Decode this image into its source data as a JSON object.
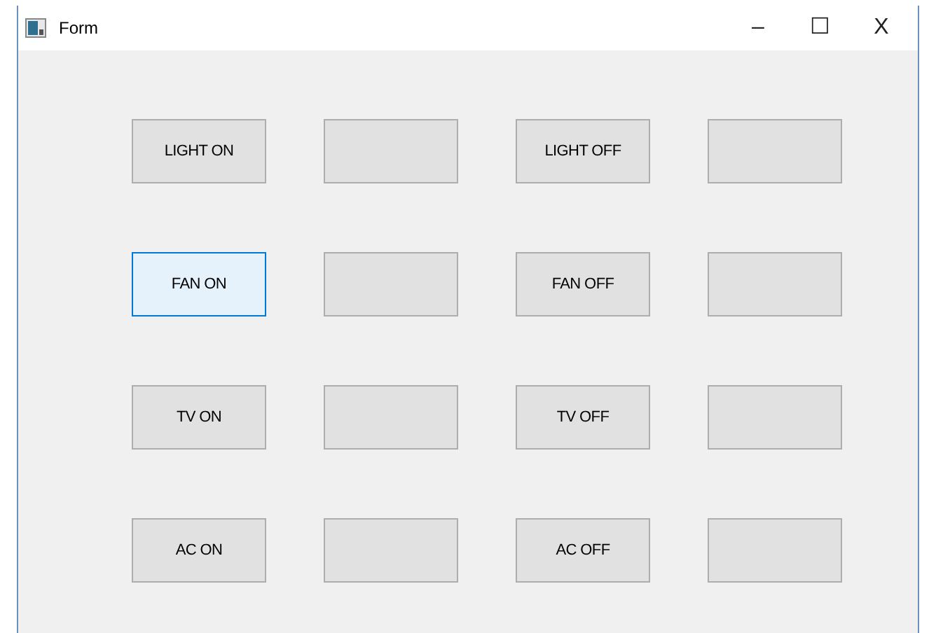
{
  "window": {
    "title": "Form",
    "controls": [
      "–",
      "☐",
      "X"
    ]
  },
  "rows": [
    {
      "buttons": [
        {
          "label": "LIGHT ON",
          "selected": false
        },
        {
          "selected": false
        },
        {
          "label": "LIGHT OFF",
          "selected": false
        },
        {
          "selected": false
        }
      ]
    },
    {
      "buttons": [
        {
          "label": "FAN ON",
          "selected": true
        },
        {
          "selected": false
        },
        {
          "label": "FAN OFF",
          "selected": false
        },
        {
          "selected": false
        }
      ]
    },
    {
      "buttons": [
        {
          "label": "TV ON",
          "selected": false
        },
        {
          "selected": false
        },
        {
          "label": "TV OFF",
          "selected": false
        },
        {
          "selected": false
        }
      ]
    },
    {
      "buttons": [
        {
          "label": "AC ON",
          "selected": false
        },
        {
          "selected": false
        },
        {
          "label": "AC OFF",
          "selected": false
        },
        {
          "selected": false
        }
      ]
    }
  ]
}
